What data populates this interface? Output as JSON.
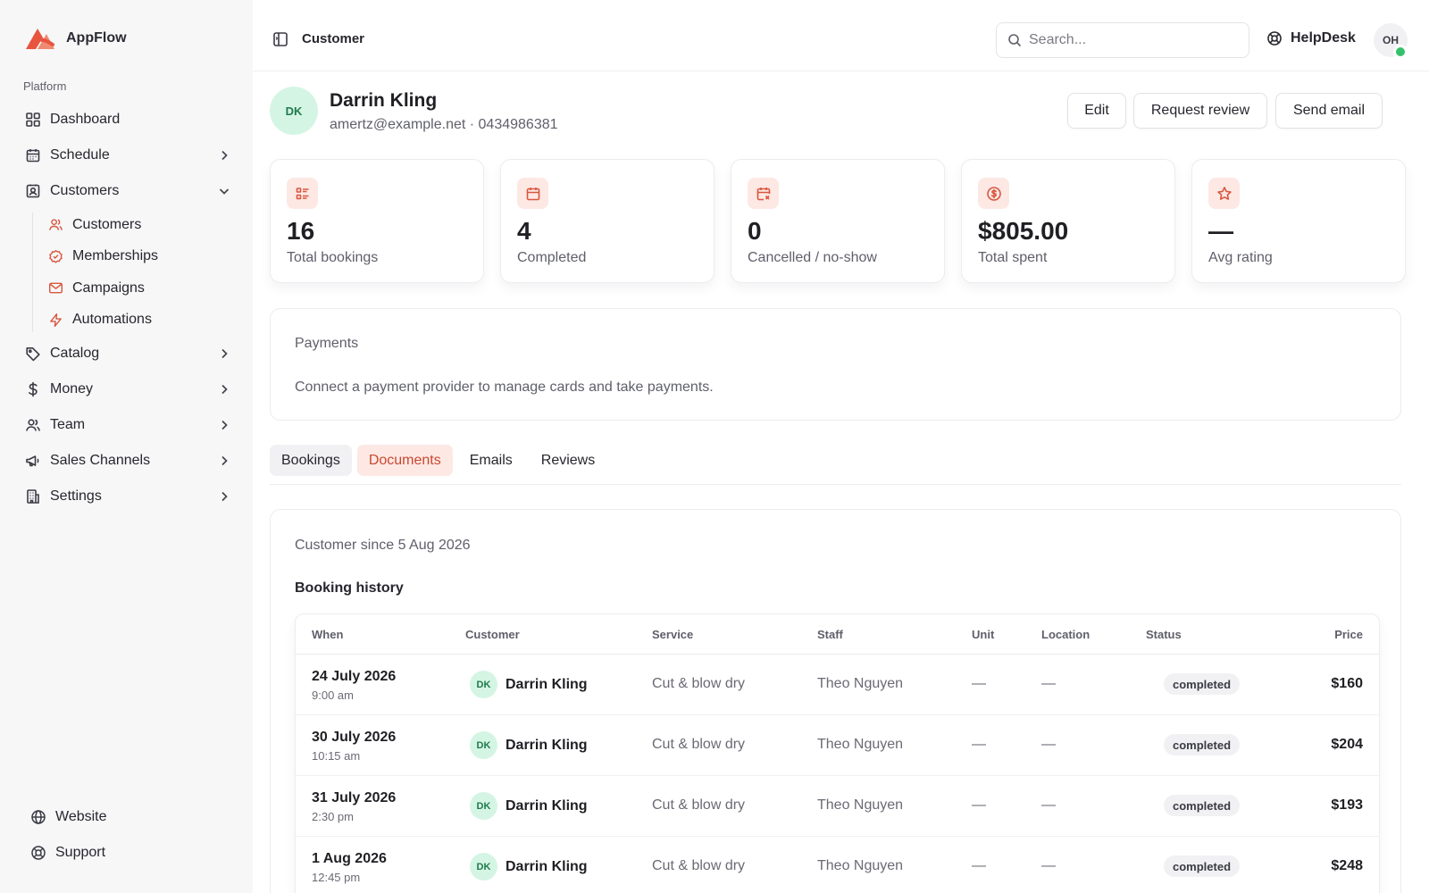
{
  "brand": {
    "name": "AppFlow",
    "logo_color": "#e8543e"
  },
  "sidebar": {
    "section_label": "Platform",
    "items": [
      {
        "label": "Dashboard",
        "icon": "grid-icon",
        "chevron": null
      },
      {
        "label": "Schedule",
        "icon": "calendar-icon",
        "chevron": "right"
      },
      {
        "label": "Customers",
        "icon": "contact-card-icon",
        "chevron": "down"
      }
    ],
    "customers_sub": [
      {
        "label": "Customers",
        "icon": "users-icon"
      },
      {
        "label": "Memberships",
        "icon": "badge-check-icon"
      },
      {
        "label": "Campaigns",
        "icon": "mail-icon"
      },
      {
        "label": "Automations",
        "icon": "zap-icon"
      }
    ],
    "items_after": [
      {
        "label": "Catalog",
        "icon": "tag-icon"
      },
      {
        "label": "Money",
        "icon": "dollar-icon"
      },
      {
        "label": "Team",
        "icon": "users-icon"
      },
      {
        "label": "Sales Channels",
        "icon": "megaphone-icon"
      },
      {
        "label": "Settings",
        "icon": "building-icon"
      }
    ],
    "bottom": [
      {
        "label": "Website",
        "icon": "globe-icon"
      },
      {
        "label": "Support",
        "icon": "lifebuoy-icon"
      }
    ]
  },
  "topbar": {
    "breadcrumb": "Customer",
    "search_placeholder": "Search...",
    "helpdesk_label": "HelpDesk",
    "user_initials": "OH",
    "online_color": "#34c16b"
  },
  "profile": {
    "initials": "DK",
    "name": "Darrin Kling",
    "contact": "amertz@example.net · 0434986381",
    "actions": {
      "edit": "Edit",
      "request_review": "Request review",
      "send_email": "Send email"
    }
  },
  "stats": [
    {
      "value": "16",
      "label": "Total bookings",
      "icon": "list-icon"
    },
    {
      "value": "4",
      "label": "Completed",
      "icon": "calendar-icon"
    },
    {
      "value": "0",
      "label": "Cancelled / no-show",
      "icon": "calendar-x-icon"
    },
    {
      "value": "$805.00",
      "label": "Total spent",
      "icon": "dollar-circle-icon"
    },
    {
      "value": "—",
      "label": "Avg rating",
      "icon": "star-icon"
    }
  ],
  "payments": {
    "title": "Payments",
    "message": "Connect a payment provider to manage cards and take payments."
  },
  "tabs": [
    {
      "label": "Bookings",
      "state": "active"
    },
    {
      "label": "Documents",
      "state": "highlight"
    },
    {
      "label": "Emails",
      "state": "normal"
    },
    {
      "label": "Reviews",
      "state": "normal"
    }
  ],
  "bookings": {
    "customer_since": "Customer since 5 Aug 2026",
    "history_title": "Booking history",
    "columns": [
      "When",
      "Customer",
      "Service",
      "Staff",
      "Unit",
      "Location",
      "Status",
      "Price"
    ],
    "rows": [
      {
        "date": "24 July 2026",
        "time": "9:00 am",
        "initials": "DK",
        "customer": "Darrin Kling",
        "service": "Cut & blow dry",
        "staff": "Theo Nguyen",
        "unit": "—",
        "location": "—",
        "status": "completed",
        "price": "$160"
      },
      {
        "date": "30 July 2026",
        "time": "10:15 am",
        "initials": "DK",
        "customer": "Darrin Kling",
        "service": "Cut & blow dry",
        "staff": "Theo Nguyen",
        "unit": "—",
        "location": "—",
        "status": "completed",
        "price": "$204"
      },
      {
        "date": "31 July 2026",
        "time": "2:30 pm",
        "initials": "DK",
        "customer": "Darrin Kling",
        "service": "Cut & blow dry",
        "staff": "Theo Nguyen",
        "unit": "—",
        "location": "—",
        "status": "completed",
        "price": "$193"
      },
      {
        "date": "1 Aug 2026",
        "time": "12:45 pm",
        "initials": "DK",
        "customer": "Darrin Kling",
        "service": "Cut & blow dry",
        "staff": "Theo Nguyen",
        "unit": "—",
        "location": "—",
        "status": "completed",
        "price": "$248"
      }
    ]
  }
}
